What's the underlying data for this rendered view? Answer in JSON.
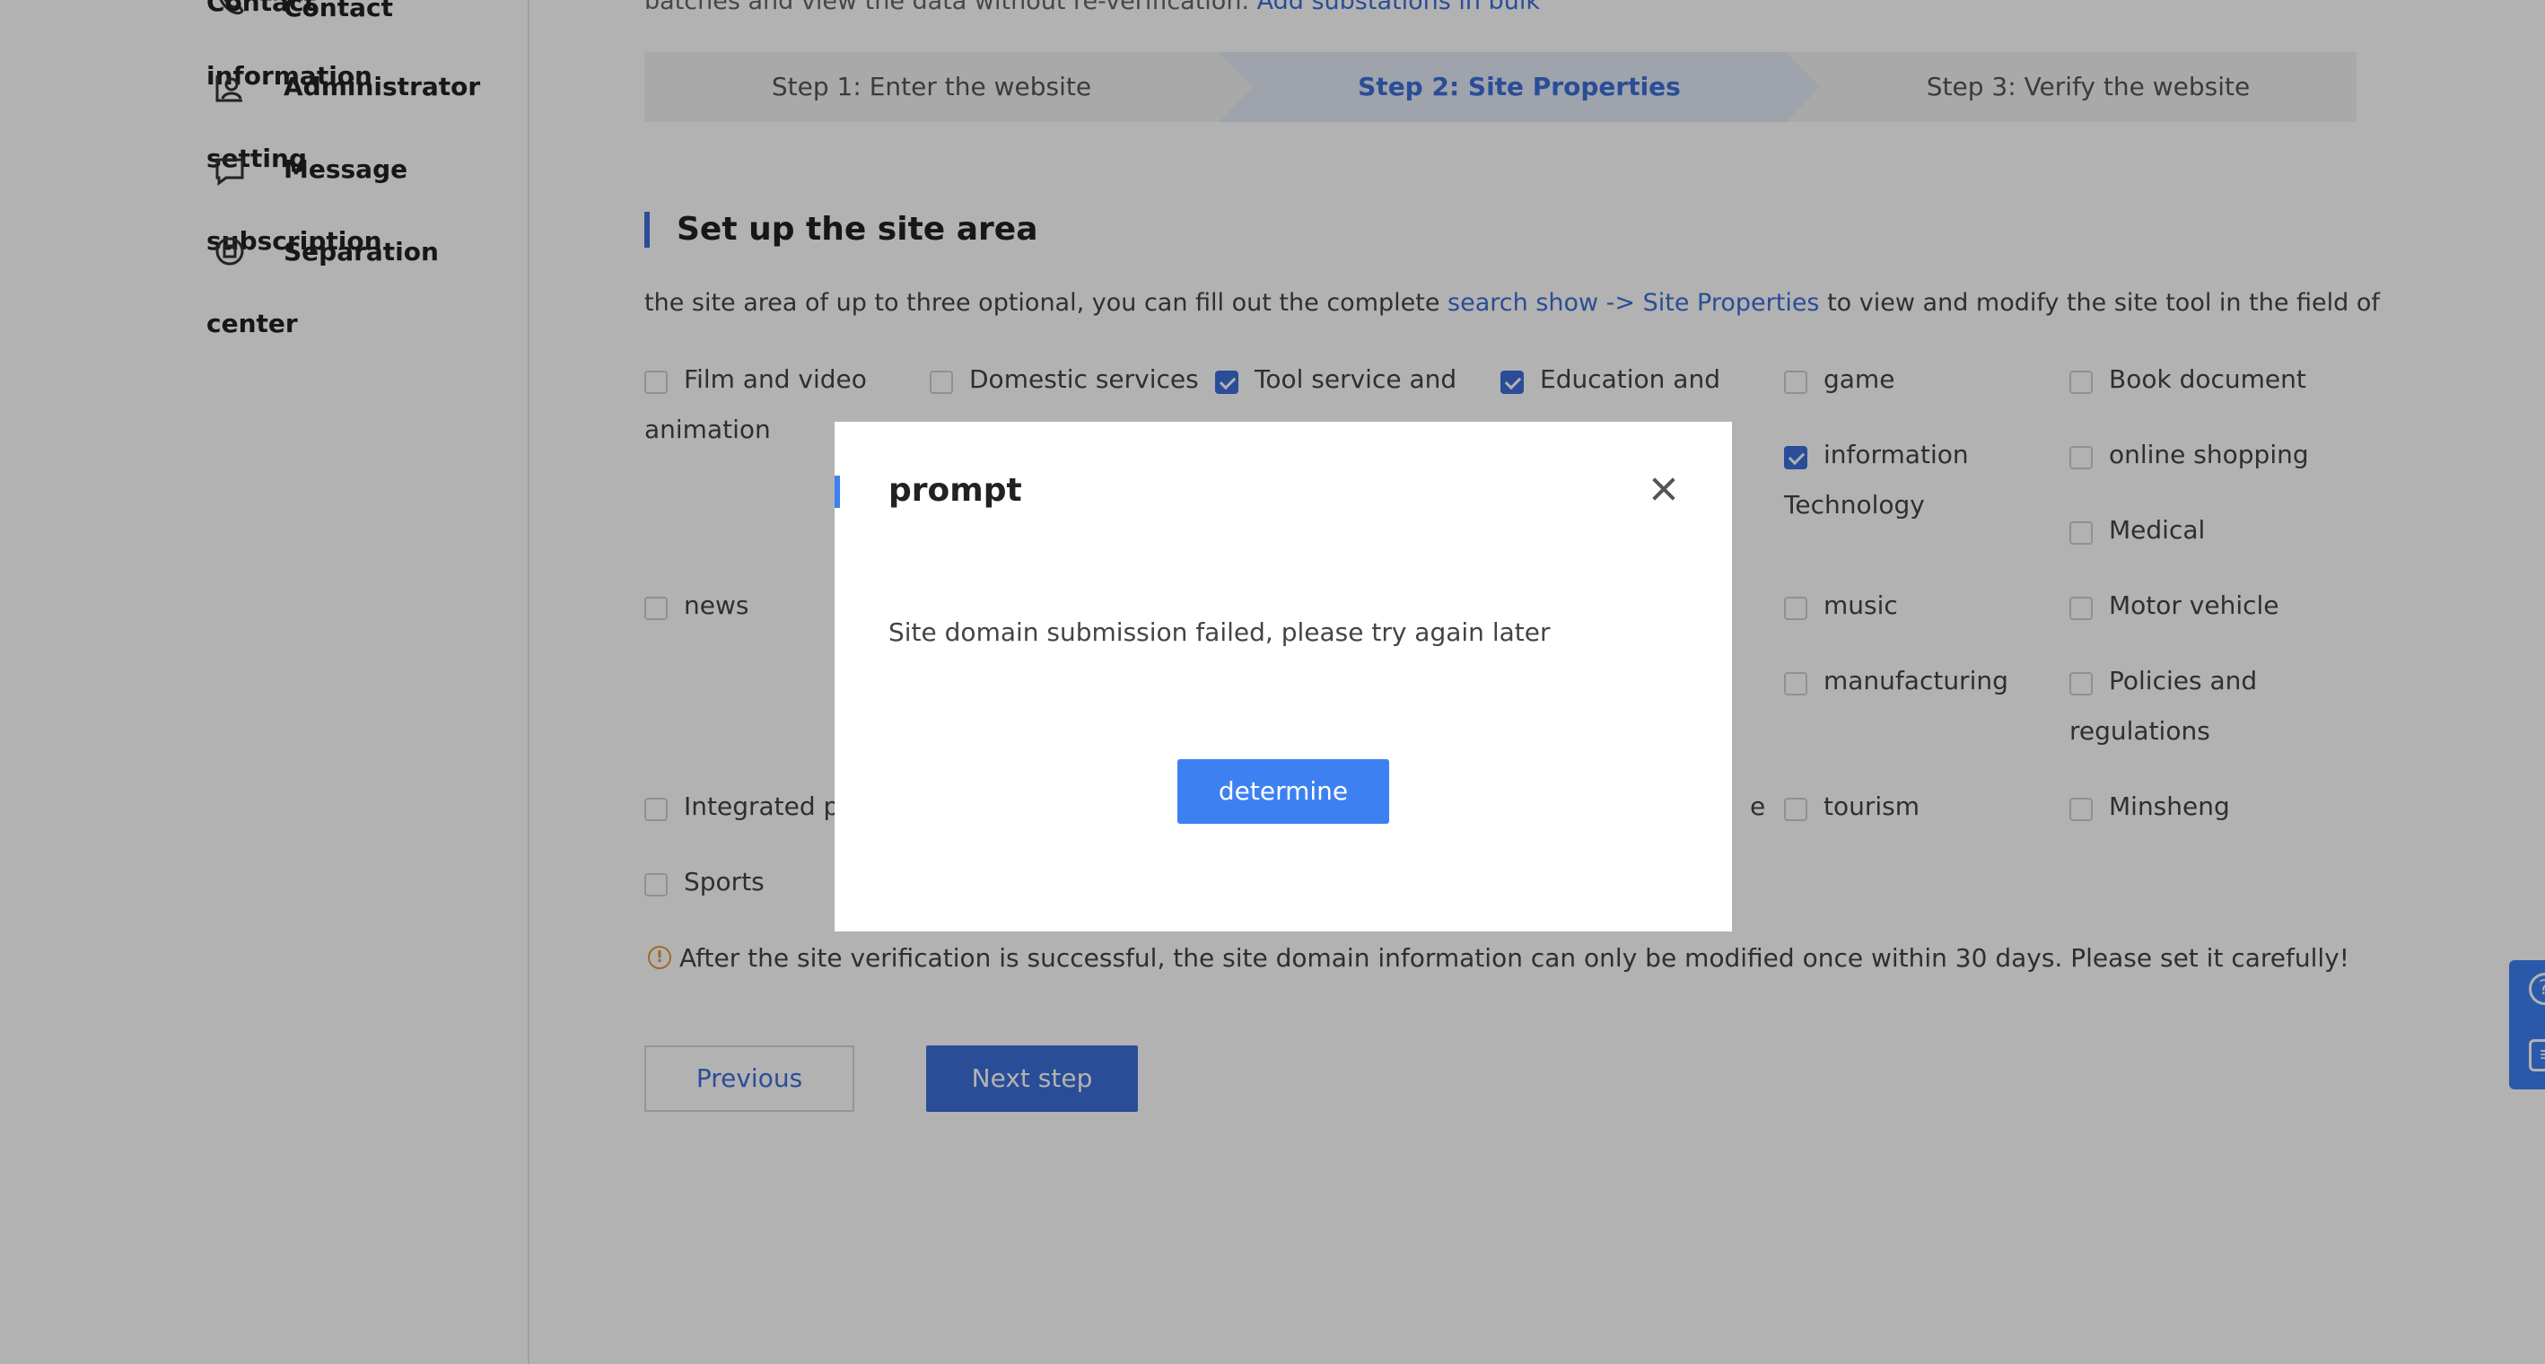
{
  "sidebar": {
    "items": [
      {
        "label": "Contact",
        "overlap_label": "Contact"
      },
      {
        "label": "Administrator",
        "overlap_label": "information"
      },
      {
        "label": "Message",
        "overlap_label": "setting"
      },
      {
        "label": "Separation",
        "overlap_label": "subscription"
      },
      {
        "label": "center"
      }
    ]
  },
  "top_note": {
    "text": "batches and view the data without re-verification.",
    "link": "Add substations in bulk"
  },
  "steps": [
    {
      "label": "Step 1: Enter the website"
    },
    {
      "label": "Step 2: Site Properties",
      "active": true
    },
    {
      "label": "Step 3: Verify the website"
    }
  ],
  "section": {
    "title": "Set up the site area",
    "desc_before": "the site area of up to three optional, you can fill out the complete",
    "desc_link": "search show -> Site Properties",
    "desc_after": "to view and modify the site tool in the field of"
  },
  "categories": [
    {
      "label": "Film and video",
      "label_line2": "animation",
      "checked": false
    },
    {
      "label": "Domestic services",
      "checked": false
    },
    {
      "label": "Tool service and",
      "checked": true
    },
    {
      "label": "Education and",
      "checked": true
    },
    {
      "label": "game",
      "checked": false
    },
    {
      "label": "Book document",
      "checked": false
    },
    {
      "label": "information",
      "label_line2": "Technology",
      "checked": true
    },
    {
      "label": "online shopping",
      "checked": false
    },
    {
      "label": "Medical",
      "checked": false
    },
    {
      "label": "news",
      "checked": false
    },
    {
      "label": "music",
      "checked": false
    },
    {
      "label": "Motor vehicle",
      "checked": false
    },
    {
      "label": "manufacturing",
      "checked": false
    },
    {
      "label": "Policies and",
      "label_line2": "regulations",
      "checked": false
    },
    {
      "label": "Integrated po",
      "checked": false
    },
    {
      "label": "e"
    },
    {
      "label": "tourism",
      "checked": false
    },
    {
      "label": "Minsheng",
      "checked": false
    },
    {
      "label": "Sports",
      "checked": false
    }
  ],
  "warning": {
    "icon": "!",
    "text": "After the site verification is successful, the site domain information can only be modified once within 30 days. Please set it carefully!"
  },
  "buttons": {
    "previous": "Previous",
    "next": "Next step"
  },
  "float_tab": {
    "help_glyph": "?",
    "list_glyph": "≡"
  },
  "modal": {
    "title": "prompt",
    "message": "Site domain submission failed, please try again later",
    "confirm": "determine"
  },
  "colors": {
    "accent": "#3d6fd8",
    "modal_button": "#3d80f2",
    "overlay": "rgba(0,0,0,0.3)",
    "warning": "#e59a3a"
  }
}
